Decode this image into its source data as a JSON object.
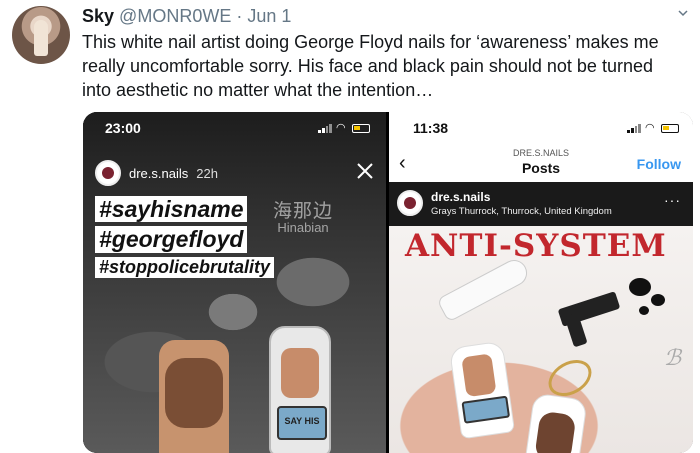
{
  "tweet": {
    "display_name": "Sky",
    "handle": "@MONR0WE",
    "separator": " · ",
    "date": "Jun 1",
    "text": "This white nail artist doing George Floyd nails for ‘awareness’ makes me really uncomfortable sorry. His face and black pain should not be turned into aesthetic no matter what the intention…"
  },
  "left_screenshot": {
    "status_time": "23:00",
    "username": "dre.s.nails",
    "posted_ago": "22h",
    "hashtags": [
      "#sayhisname",
      "#georgefloyd",
      "#stoppolicebrutality"
    ],
    "watermark_cn": "海那边",
    "watermark_en": "Hinabian",
    "armband_text": "SAY HIS"
  },
  "right_screenshot": {
    "status_time": "11:38",
    "account_label": "DRE.S.NAILS",
    "page_title": "Posts",
    "follow_label": "Follow",
    "username": "dre.s.nails",
    "location": "Grays Thurrock, Thurrock, United Kingdom",
    "more_label": "···",
    "artwork_text": "ANTI-SYSTEM"
  },
  "icons": {
    "tweet_menu": "chevron-down-icon",
    "story_close": "close-icon",
    "back": "back-chevron-icon",
    "signal": "signal-icon",
    "wifi": "wifi-icon",
    "battery": "battery-icon"
  },
  "colors": {
    "text_primary": "#14171a",
    "text_secondary": "#657786",
    "instagram_blue": "#3897f0",
    "artwork_red": "#c2272d"
  }
}
